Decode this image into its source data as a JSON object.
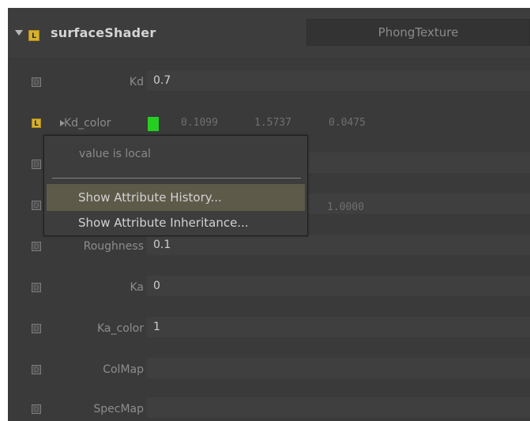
{
  "header": {
    "shader_name": "surfaceShader",
    "shader_type": "PhongTexture",
    "badge": "L"
  },
  "attributes": [
    {
      "name": "Kd",
      "value": "0.7",
      "badge": "D"
    },
    {
      "name": "Kd_color",
      "values": [
        "0.1099",
        "1.5737",
        "0.0475"
      ],
      "badge": "L",
      "swatch_color": "#25cf21"
    },
    {
      "name": "",
      "value": "",
      "badge": "D"
    },
    {
      "name": "",
      "value": "1.0000",
      "badge": "D"
    },
    {
      "name": "Roughness",
      "value": "0.1",
      "badge": "D"
    },
    {
      "name": "Ka",
      "value": "0",
      "badge": "D"
    },
    {
      "name": "Ka_color",
      "value": "1",
      "badge": "D"
    },
    {
      "name": "ColMap",
      "value": "",
      "badge": "D"
    },
    {
      "name": "SpecMap",
      "value": "",
      "badge": "D"
    }
  ],
  "context_menu": {
    "title": "value is local",
    "items": [
      {
        "label": "Show Attribute History..."
      },
      {
        "label": "Show Attribute Inheritance..."
      }
    ]
  },
  "colors": {
    "background": "#3a3a3a",
    "field": "#3f3f3f",
    "local_badge": "#d7b12d",
    "default_badge": "#4b4b4b",
    "menu_highlight": "#5d5a49"
  },
  "icons": {
    "expand_arrow": "triangle-down-icon",
    "row_arrow": "triangle-right-icon",
    "cursor": "pointer-icon"
  }
}
